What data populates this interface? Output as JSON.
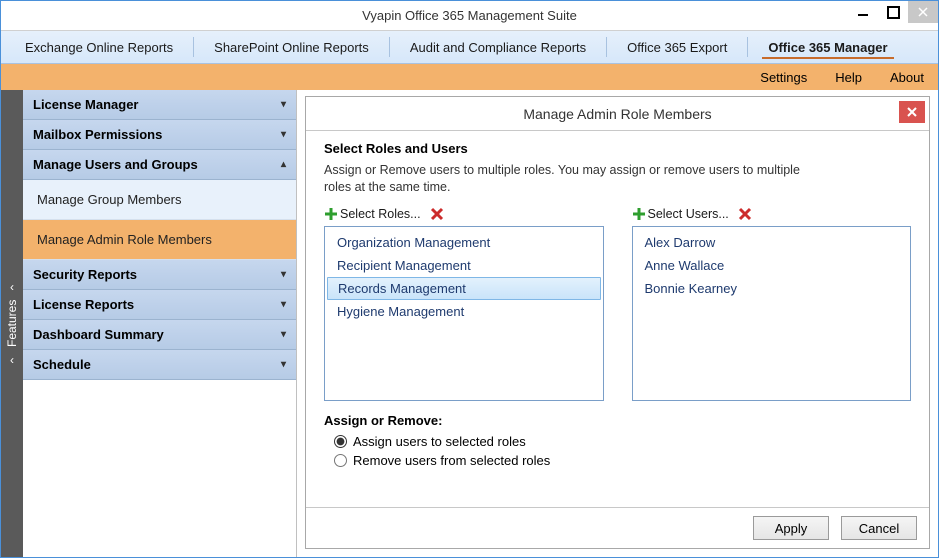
{
  "window": {
    "title": "Vyapin Office 365 Management Suite"
  },
  "ribbon": {
    "tabs": [
      {
        "label": "Exchange Online Reports"
      },
      {
        "label": "SharePoint Online Reports"
      },
      {
        "label": "Audit and Compliance Reports"
      },
      {
        "label": "Office 365 Export"
      },
      {
        "label": "Office 365 Manager"
      }
    ],
    "activeIndex": 4
  },
  "subbar": {
    "settings": "Settings",
    "help": "Help",
    "about": "About"
  },
  "featuresRail": {
    "label": "Features"
  },
  "sidebar": {
    "cats": [
      {
        "label": "License Manager",
        "expanded": false
      },
      {
        "label": "Mailbox Permissions",
        "expanded": false
      },
      {
        "label": "Manage Users and Groups",
        "expanded": true,
        "subs": [
          {
            "label": "Manage Group Members"
          },
          {
            "label": "Manage Admin Role Members"
          }
        ],
        "activeSub": 1
      },
      {
        "label": "Security Reports",
        "expanded": false
      },
      {
        "label": "License Reports",
        "expanded": false
      },
      {
        "label": "Dashboard Summary",
        "expanded": false
      },
      {
        "label": "Schedule",
        "expanded": false
      }
    ]
  },
  "panel": {
    "title": "Manage Admin Role Members",
    "section_title": "Select Roles and Users",
    "section_desc": "Assign or Remove users to multiple roles. You may assign or remove users to multiple roles at the same time.",
    "roles": {
      "add_label": "Select Roles...",
      "items": [
        "Organization Management",
        "Recipient Management",
        "Records Management",
        "Hygiene Management"
      ],
      "selectedIndex": 2
    },
    "users": {
      "add_label": "Select Users...",
      "items": [
        "Alex Darrow",
        "Anne Wallace",
        "Bonnie Kearney"
      ],
      "selectedIndex": -1
    },
    "assign": {
      "title": "Assign or Remove:",
      "opt_assign": "Assign users to selected roles",
      "opt_remove": "Remove users from selected roles",
      "selected": "assign"
    },
    "footer": {
      "apply": "Apply",
      "cancel": "Cancel"
    }
  }
}
